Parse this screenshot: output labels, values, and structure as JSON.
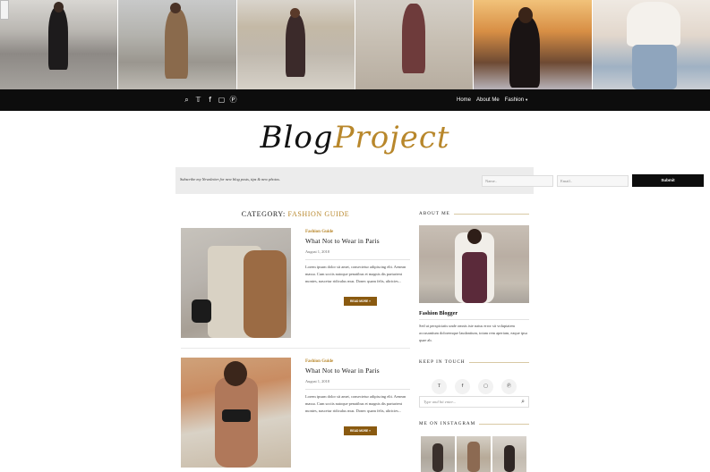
{
  "header": {
    "photos": [
      {
        "name": "street-style-photo-1"
      },
      {
        "name": "street-style-photo-2"
      },
      {
        "name": "street-style-photo-3"
      },
      {
        "name": "street-style-photo-4"
      },
      {
        "name": "street-style-photo-5"
      },
      {
        "name": "street-style-photo-6"
      }
    ],
    "social_icons": [
      "search-icon",
      "twitter-icon",
      "facebook-icon",
      "instagram-icon",
      "pinterest-icon"
    ],
    "menu": {
      "home": "Home",
      "about": "About Me",
      "fashion": "Fashion"
    }
  },
  "logo": {
    "part1": "Blog",
    "part2": "Project"
  },
  "newsletter": {
    "text": "Subscribe my Newsletter for new blog posts, tips & new photos.",
    "name_placeholder": "Name..",
    "email_placeholder": "Email..",
    "submit": "Submit"
  },
  "category": {
    "label": "CATEGORY:",
    "name": "FASHION GUIDE"
  },
  "posts": [
    {
      "category": "Fashion Guide",
      "title": "What Not to Wear in Paris",
      "date": "August 1, 2018",
      "excerpt": "Lorem ipsum dolor sit amet, consectetur adipiscing elit. Aenean massa. Cum sociis natoque penatibus et magnis dis parturient montes, nascetur ridiculus mus. Donec quam felis, ultricies...",
      "read_more": "READ MORE »"
    },
    {
      "category": "Fashion Guide",
      "title": "What Not to Wear in Paris",
      "date": "August 1, 2018",
      "excerpt": "Lorem ipsum dolor sit amet, consectetur adipiscing elit. Aenean massa. Cum sociis natoque penatibus et magnis dis parturient montes, nascetur ridiculus mus. Donec quam felis, ultricies...",
      "read_more": "READ MORE »"
    }
  ],
  "sidebar": {
    "about_heading": "ABOUT ME",
    "about_name": "Fashion Blogger",
    "about_text": "Sed ut perspiciatis unde omnis iste natus error sit voluptatem accusantium doloremque laudantium, totam rem aperiam, eaque ipsa quae ab.",
    "touch_heading": "KEEP IN TOUCH",
    "touch_icons": [
      "twitter-icon",
      "facebook-icon",
      "instagram-icon",
      "pinterest-icon"
    ],
    "search_placeholder": "Type and hit enter...",
    "insta_heading": "ME ON INSTAGRAM"
  },
  "colors": {
    "accent": "#b8872b",
    "nav_bg": "#0d0d0d",
    "read_more_bg": "#8a5a10"
  }
}
